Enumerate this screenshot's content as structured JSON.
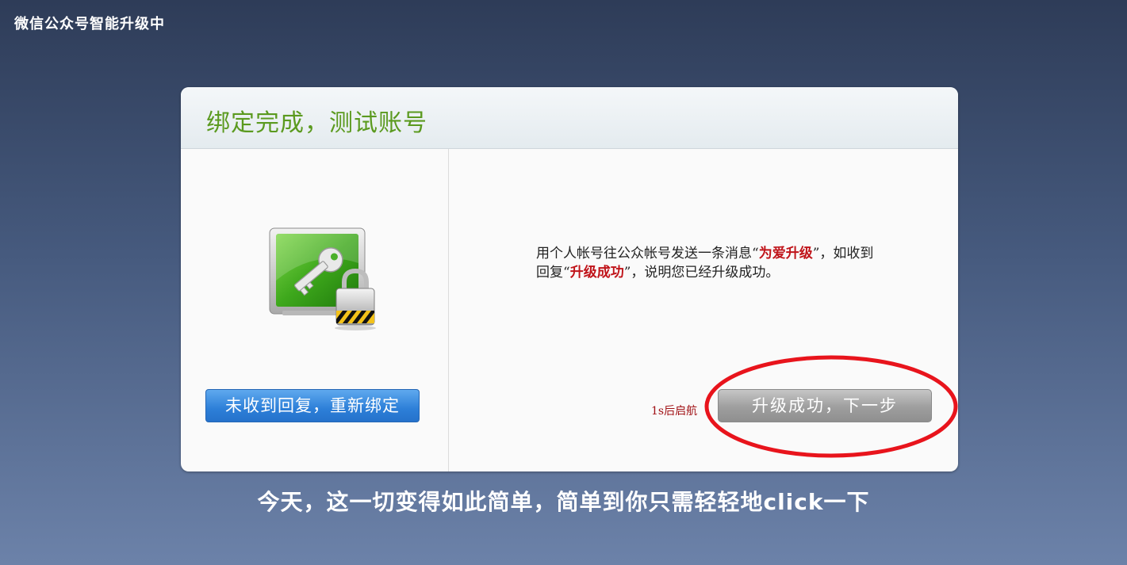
{
  "page": {
    "top_title": "微信公众号智能升级中",
    "bottom_caption": "今天，这一切变得如此简单，简单到你只需轻轻地click一下"
  },
  "card": {
    "title": "绑定完成，测试账号",
    "icon": "key-lock-icon",
    "instruction": {
      "part1": "用个人帐号往公众帐号发送一条消息“",
      "keyword": "为爱升级",
      "part2": "”，如收到回复“",
      "reply": "升级成功",
      "part3": "”，说明您已经升级成功。"
    },
    "rebind_button": "未收到回复，重新绑定",
    "countdown": "1s后启航",
    "next_button": "升级成功，下一步"
  },
  "colors": {
    "title_green": "#5b9a1f",
    "highlight_red": "#c0141a",
    "annotation_red": "#e8141c",
    "button_blue": "#2d7fd8",
    "button_gray": "#9e9e9e"
  }
}
